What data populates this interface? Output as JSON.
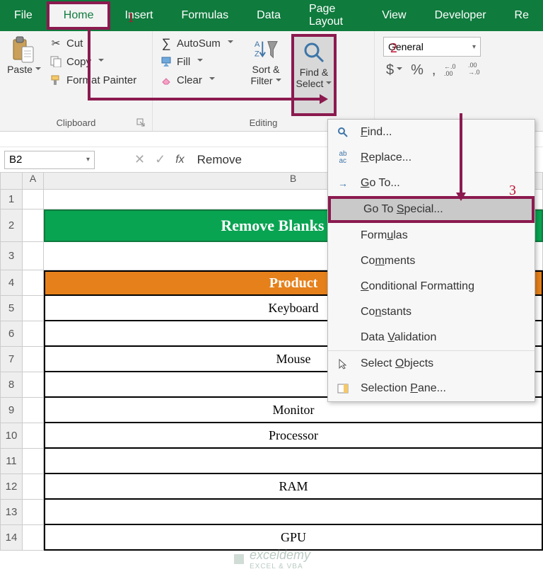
{
  "tabs": {
    "file": "File",
    "home": "Home",
    "insert": "Insert",
    "formulas": "Formulas",
    "data": "Data",
    "page_layout": "Page Layout",
    "view": "View",
    "developer": "Developer",
    "extra": "Re"
  },
  "clipboard": {
    "paste": "Paste",
    "cut": "Cut",
    "copy": "Copy",
    "format_painter": "Format Painter",
    "group": "Clipboard"
  },
  "editing": {
    "autosum": "AutoSum",
    "fill": "Fill",
    "clear": "Clear",
    "sort_filter_line1": "Sort &",
    "sort_filter_line2": "Filter",
    "find_select_line1": "Find &",
    "find_select_line2": "Select",
    "group": "Editing"
  },
  "number_format": {
    "selected": "General",
    "dollar": "$",
    "percent": "%",
    "comma": ",",
    "inc_dec": ".0",
    "dec_dec": ".00"
  },
  "namebox": {
    "ref": "B2"
  },
  "formula_bar": {
    "value": "Remove"
  },
  "find_menu": {
    "find": "Find...",
    "replace": "Replace...",
    "goto": "Go To...",
    "goto_special": "Go To Special...",
    "formulas_item": "Formulas",
    "comments": "Comments",
    "cond_fmt": "Conditional Formatting",
    "constants": "Constants",
    "data_val": "Data Validation",
    "sel_obj": "Select Objects",
    "sel_pane": "Selection Pane..."
  },
  "sheet": {
    "col_A": "A",
    "col_B": "B",
    "title": "Remove Blanks Using",
    "header": "Product",
    "rows": {
      "r5": "Keyboard",
      "r6": "",
      "r7": "Mouse",
      "r8": "",
      "r9": "Monitor",
      "r10": "Processor",
      "r11": "",
      "r12": "RAM",
      "r13": "",
      "r14": "GPU"
    },
    "rownums": [
      "1",
      "2",
      "3",
      "4",
      "5",
      "6",
      "7",
      "8",
      "9",
      "10",
      "11",
      "12",
      "13",
      "14"
    ]
  },
  "callouts": {
    "one": "1",
    "two": "2",
    "three": "3"
  },
  "watermark": {
    "main": "exceldemy",
    "sub": "EXCEL & VBA"
  }
}
